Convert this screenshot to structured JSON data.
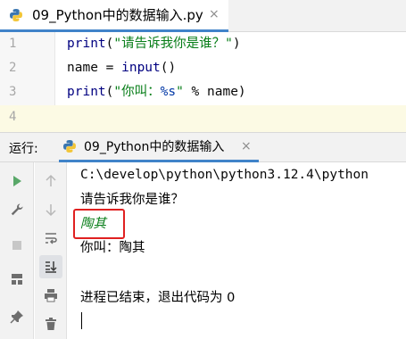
{
  "editor_tab": {
    "title": "09_Python中的数据输入.py",
    "close": "×"
  },
  "code_lines": [
    {
      "num": "1",
      "text": "print(\"请告诉我你是谁？\")"
    },
    {
      "num": "2",
      "text": "name = input()"
    },
    {
      "num": "3",
      "text": "print(\"你叫：%s\" % name)"
    },
    {
      "num": "4",
      "text": ""
    }
  ],
  "run_panel": {
    "label": "运行:",
    "tab_title": "09_Python中的数据输入",
    "tab_close": "×"
  },
  "console": {
    "path_line": "C:\\develop\\python\\python3.12.4\\python",
    "prompt_line": "请告诉我你是谁？",
    "user_input": "陶其",
    "output_line": "你叫：陶其",
    "exit_line": "进程已结束，退出代码为 0"
  },
  "icons": {
    "run": "run-icon",
    "wrench": "wrench-icon",
    "stop": "stop-icon",
    "layout": "layout-icon",
    "pin": "pin-icon",
    "up": "arrow-up-icon",
    "down": "arrow-down-icon",
    "wrap": "soft-wrap-icon",
    "scroll_end": "scroll-to-end-icon",
    "print": "print-icon",
    "trash": "trash-icon"
  },
  "colors": {
    "accent": "#4083c9",
    "keyword": "#000080",
    "string": "#067d17",
    "highlight": "#e02020",
    "run_green": "#59a869"
  }
}
